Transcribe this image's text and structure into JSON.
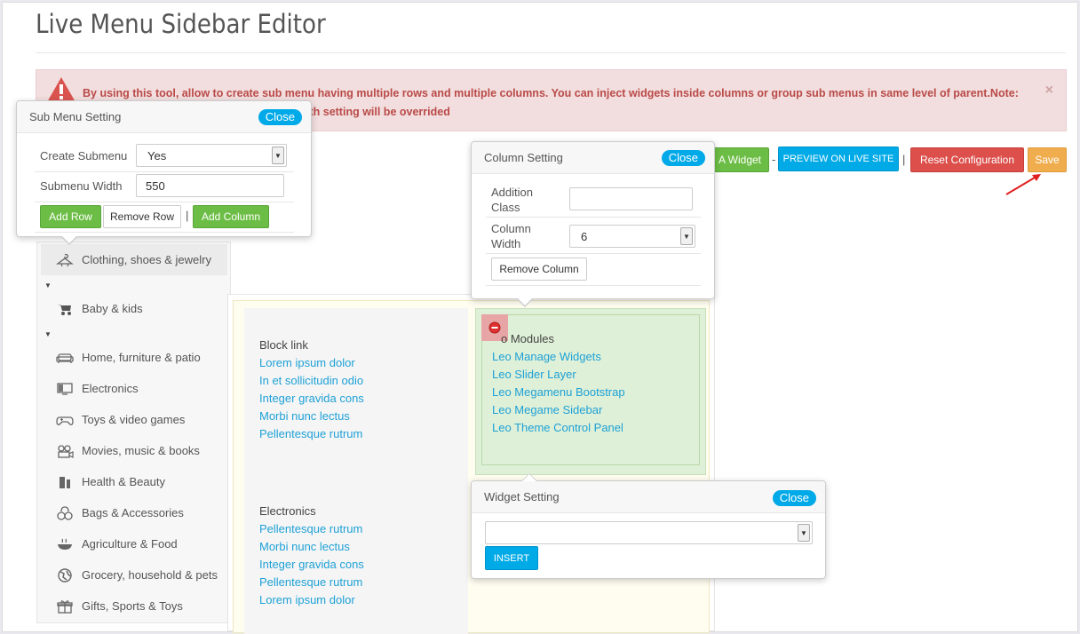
{
  "page": {
    "title": "Live Menu Sidebar Editor"
  },
  "alert": {
    "line1": "By using this tool, allow to create sub menu having multiple rows and multiple columns. You can inject widgets inside columns or group sub menus in same level of parent.Note:",
    "line2": "lth setting will be overrided",
    "close": "×"
  },
  "toolbar": {
    "add_widget": "A Widget",
    "dash": "-",
    "preview": "PREVIEW ON LIVE SITE",
    "pipe": "|",
    "reset": "Reset Configuration",
    "save": "Save"
  },
  "submenu_setting": {
    "title": "Sub Menu Setting",
    "close": "Close",
    "create_label": "Create Submenu",
    "create_value": "Yes",
    "width_label": "Submenu Width",
    "width_value": "550",
    "add_row": "Add Row",
    "remove_row": "Remove Row",
    "pipe": "|",
    "add_column": "Add Column"
  },
  "column_setting": {
    "title": "Column Setting",
    "close": "Close",
    "class_label_1": "Addition",
    "class_label_2": "Class",
    "class_value": "",
    "width_label_1": "Column",
    "width_label_2": "Width",
    "width_value": "6",
    "remove_column": "Remove Column"
  },
  "widget_setting": {
    "title": "Widget Setting",
    "close": "Close",
    "select_value": "",
    "insert": "INSERT"
  },
  "sidebar": {
    "items": [
      {
        "label": "Clothing, shoes & jewelry",
        "icon": "hanger-icon"
      },
      {
        "label": "Baby & kids",
        "icon": "stroller-icon"
      },
      {
        "label": "Home, furniture & patio",
        "icon": "sofa-icon"
      },
      {
        "label": "Electronics",
        "icon": "monitor-icon"
      },
      {
        "label": "Toys & video games",
        "icon": "gamepad-icon"
      },
      {
        "label": "Movies, music & books",
        "icon": "film-icon"
      },
      {
        "label": "Health & Beauty",
        "icon": "cosmetics-icon"
      },
      {
        "label": "Bags & Accessories",
        "icon": "bag-icon"
      },
      {
        "label": "Agriculture & Food",
        "icon": "food-icon"
      },
      {
        "label": "Grocery, household & pets",
        "icon": "globe-icon"
      },
      {
        "label": "Gifts, Sports & Toys",
        "icon": "gift-icon"
      }
    ]
  },
  "columns": {
    "block_link": {
      "title": "Block link",
      "links": [
        "Lorem ipsum dolor",
        "In et sollicitudin odio",
        "Integer gravida cons",
        "Morbi nunc lectus",
        "Pellentesque rutrum"
      ]
    },
    "leo_modules": {
      "title": "o Modules",
      "links": [
        "Leo Manage Widgets",
        "Leo Slider Layer",
        "Leo Megamenu Bootstrap",
        "Leo Megame Sidebar",
        "Leo Theme Control Panel"
      ]
    },
    "electronics": {
      "title": "Electronics",
      "links": [
        "Pellentesque rutrum",
        "Morbi nunc lectus",
        "Integer gravida cons",
        "Pellentesque rutrum",
        "Lorem ipsum dolor"
      ]
    }
  },
  "colors": {
    "accent": "#00aae7",
    "green": "#6cbd45",
    "danger": "#dc4f4b",
    "save": "#f0ad4e"
  }
}
